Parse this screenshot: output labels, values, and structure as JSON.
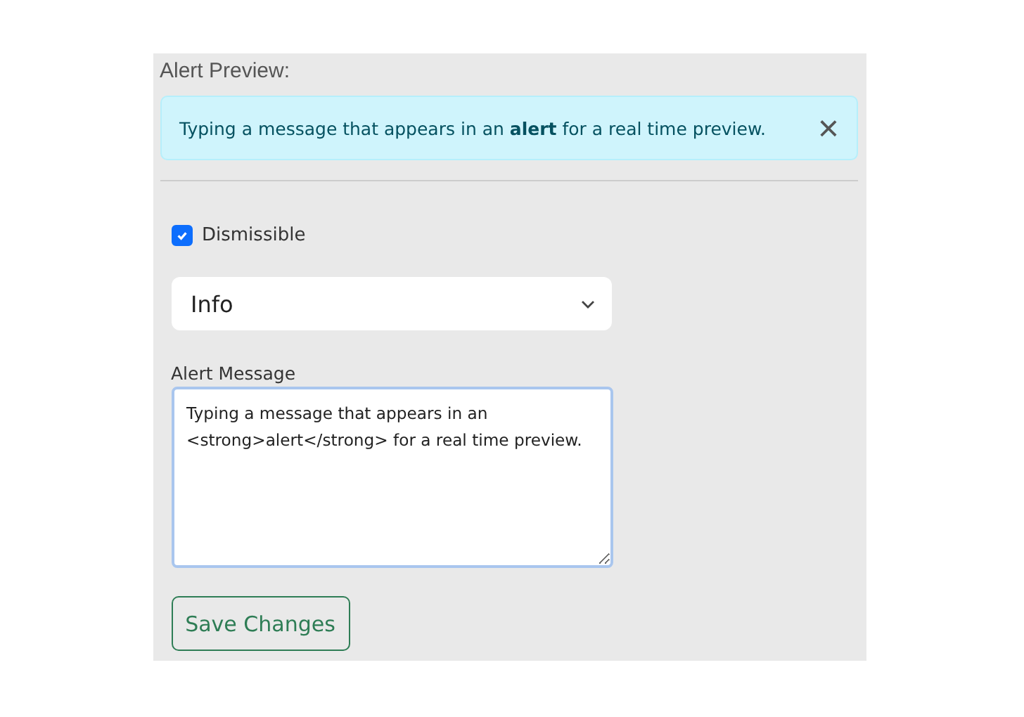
{
  "preview": {
    "heading": "Alert Preview:",
    "alert": {
      "message": "Typing a message that appears in an **alert** for a real time preview.",
      "kind": "info",
      "dismissible": true,
      "close": "×"
    }
  },
  "form": {
    "dismissible": {
      "label": "Dismissible",
      "checked": true
    },
    "type_select": {
      "value": "Info"
    },
    "message": {
      "label": "Alert Message",
      "value": "Typing a message that appears in an <strong>alert</strong> for a real time preview."
    },
    "save_button": "Save Changes"
  }
}
